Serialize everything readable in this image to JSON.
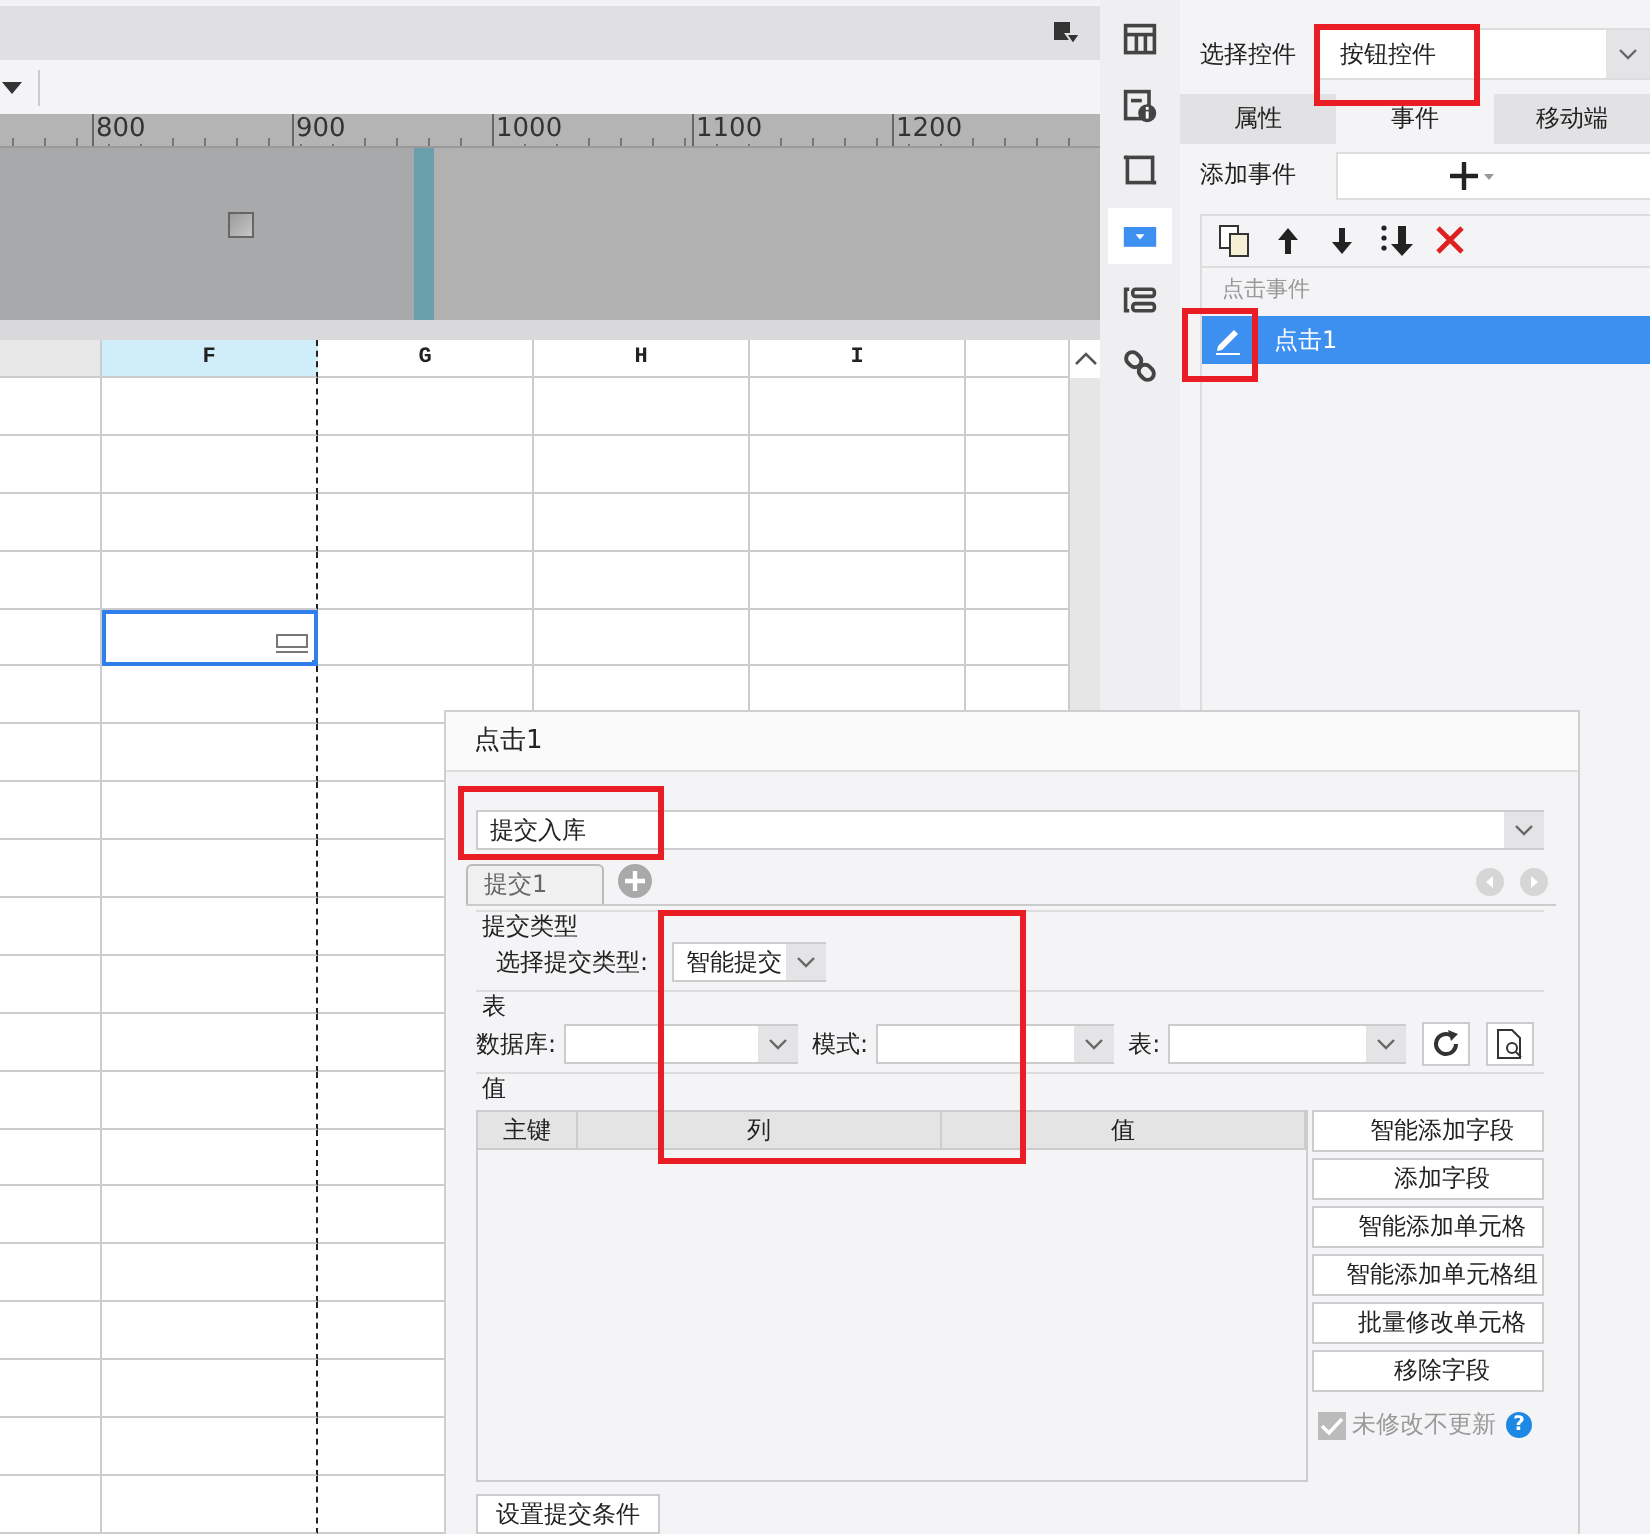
{
  "ruler": {
    "labels": [
      "800",
      "900",
      "1000",
      "1100",
      "1200"
    ]
  },
  "sheet": {
    "columns": [
      {
        "label": "F",
        "selected": true
      },
      {
        "label": "G",
        "selected": false
      },
      {
        "label": "H",
        "selected": false
      },
      {
        "label": "I",
        "selected": false
      }
    ],
    "rows": [
      {
        "selected": false
      },
      {
        "selected": false
      },
      {
        "selected": false
      },
      {
        "selected": false
      },
      {
        "selected": true
      },
      {
        "selected": false
      },
      {
        "selected": false
      },
      {
        "selected": false
      },
      {
        "selected": false
      },
      {
        "selected": false
      },
      {
        "selected": false
      },
      {
        "selected": false
      },
      {
        "selected": false
      },
      {
        "selected": false
      },
      {
        "selected": false
      },
      {
        "selected": false
      },
      {
        "selected": false
      },
      {
        "selected": false
      },
      {
        "selected": false
      },
      {
        "selected": false
      }
    ]
  },
  "tool_strip": [
    {
      "kind": "layout",
      "selected": false
    },
    {
      "kind": "info",
      "selected": false
    },
    {
      "kind": "frame",
      "selected": false
    },
    {
      "kind": "dropdown",
      "selected": true
    },
    {
      "kind": "list",
      "selected": false
    },
    {
      "kind": "link",
      "selected": false
    }
  ],
  "control_picker": {
    "label": "选择控件",
    "value": "按钮控件"
  },
  "tabs": [
    {
      "label": "属性",
      "selected": false
    },
    {
      "label": "事件",
      "selected": true
    },
    {
      "label": "移动端",
      "selected": false
    }
  ],
  "add_event": {
    "label": "添加事件"
  },
  "event_toolbar": [
    {
      "kind": "copy"
    },
    {
      "kind": "up"
    },
    {
      "kind": "down"
    },
    {
      "kind": "bottom"
    },
    {
      "kind": "delete"
    }
  ],
  "event_groups": [
    {
      "label": "点击事件",
      "events": [
        {
          "label": "点击1",
          "selected": true
        }
      ]
    }
  ],
  "dialog": {
    "title": "点击1",
    "action": "提交入库",
    "tabs": [
      {
        "label": "提交1",
        "selected": true
      }
    ],
    "submit_type": {
      "heading": "提交类型",
      "label": "选择提交类型:",
      "value": "智能提交"
    },
    "table_section": {
      "heading": "表",
      "fields": [
        {
          "label": "数据库:"
        },
        {
          "label": "模式:"
        },
        {
          "label": "表:"
        }
      ]
    },
    "values_section": {
      "heading": "值",
      "columns": [
        "主键",
        "列",
        "值"
      ],
      "buttons": [
        "智能添加字段",
        "添加字段",
        "智能添加单元格",
        "智能添加单元格组",
        "批量修改单元格",
        "移除字段"
      ],
      "checkbox": {
        "label": "未修改不更新",
        "checked": true,
        "disabled": true
      },
      "help": "?"
    },
    "footer_button": "设置提交条件"
  }
}
